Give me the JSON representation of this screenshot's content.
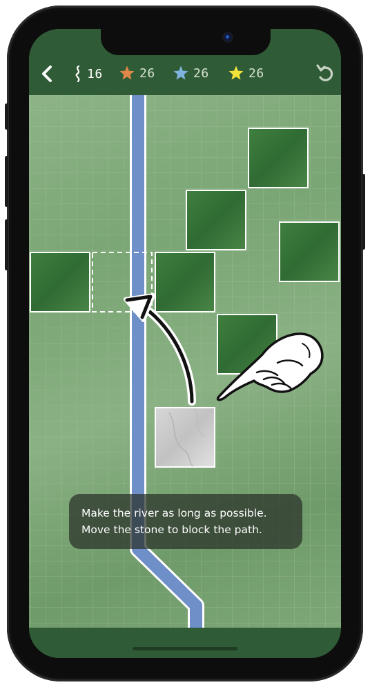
{
  "hud": {
    "moves": "16",
    "star_orange": "26",
    "star_blue": "26",
    "star_yellow": "26"
  },
  "colors": {
    "background": "#2f5c37",
    "grass": "#7aa574",
    "forest": "#3f7a3e",
    "river": "#6f8fc8",
    "star_orange": "#e0884a",
    "star_blue": "#7fb2dc",
    "star_yellow": "#f2e23a"
  },
  "icons": [
    "back-icon",
    "river-moves-icon",
    "star-icon",
    "undo-icon",
    "pointing-hand-icon",
    "curved-arrow-icon"
  ],
  "tutorial": {
    "line1": "Make the river as long as possible.",
    "line2": "Move the stone to block the path."
  }
}
